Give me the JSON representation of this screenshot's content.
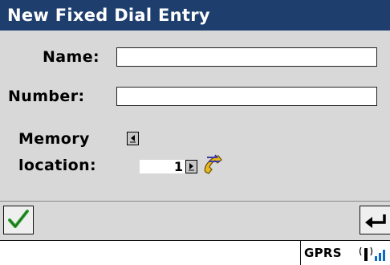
{
  "window": {
    "title": "New Fixed Dial Entry"
  },
  "form": {
    "name_label": "Name:",
    "name_value": "",
    "number_label": "Number:",
    "number_value": "",
    "memory_label_line1": "Memory",
    "memory_label_line2": "location:",
    "memory_value": "1"
  },
  "icons": {
    "ok": "checkmark-icon",
    "back": "back-arrow-icon",
    "phone": "phone-handset-icon",
    "signal": "signal-strength-icon"
  },
  "status": {
    "network": "GPRS"
  },
  "colors": {
    "title_bg": "#1e3f6e",
    "title_fg": "#ffffff",
    "check": "#2ea02e"
  }
}
